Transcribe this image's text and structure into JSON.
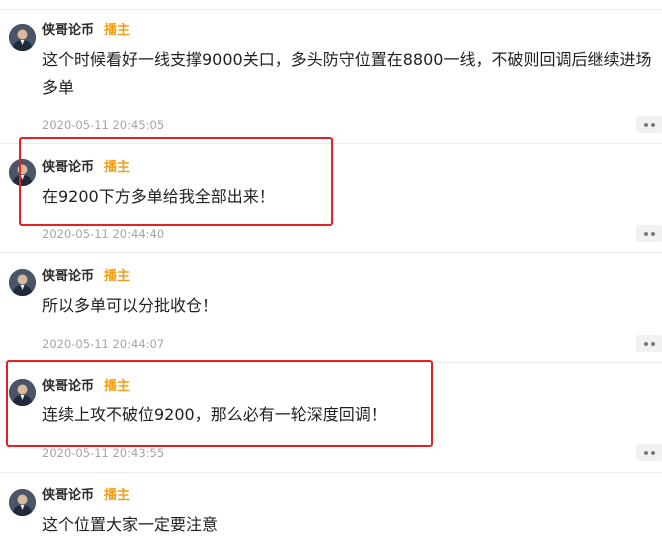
{
  "posts": [
    {
      "username": "侠哥论币",
      "role": "播主",
      "line1": "这个时候看好一线支撑9000关口，多头防守位置在8800一线，不破则回调后继续进场",
      "line2": "多单",
      "time": "2020-05-11 20:45:05"
    },
    {
      "username": "侠哥论币",
      "role": "播主",
      "text": "在9200下方多单给我全部出来！",
      "time": "2020-05-11 20:44:40"
    },
    {
      "username": "侠哥论币",
      "role": "播主",
      "text": "所以多单可以分批收仓！",
      "time": "2020-05-11 20:44:07"
    },
    {
      "username": "侠哥论币",
      "role": "播主",
      "text": "连续上攻不破位9200，那么必有一轮深度回调！",
      "time": "2020-05-11 20:43:55"
    },
    {
      "username": "侠哥论币",
      "role": "播主",
      "text": "这个位置大家一定要注意"
    }
  ],
  "icons": {
    "avatar": "avatar-icon",
    "more": "more-icon"
  },
  "colors": {
    "role_badge": "#f0a11c",
    "highlight": "#e52222",
    "timestamp": "#a5a5a5",
    "divider": "#ececec"
  }
}
